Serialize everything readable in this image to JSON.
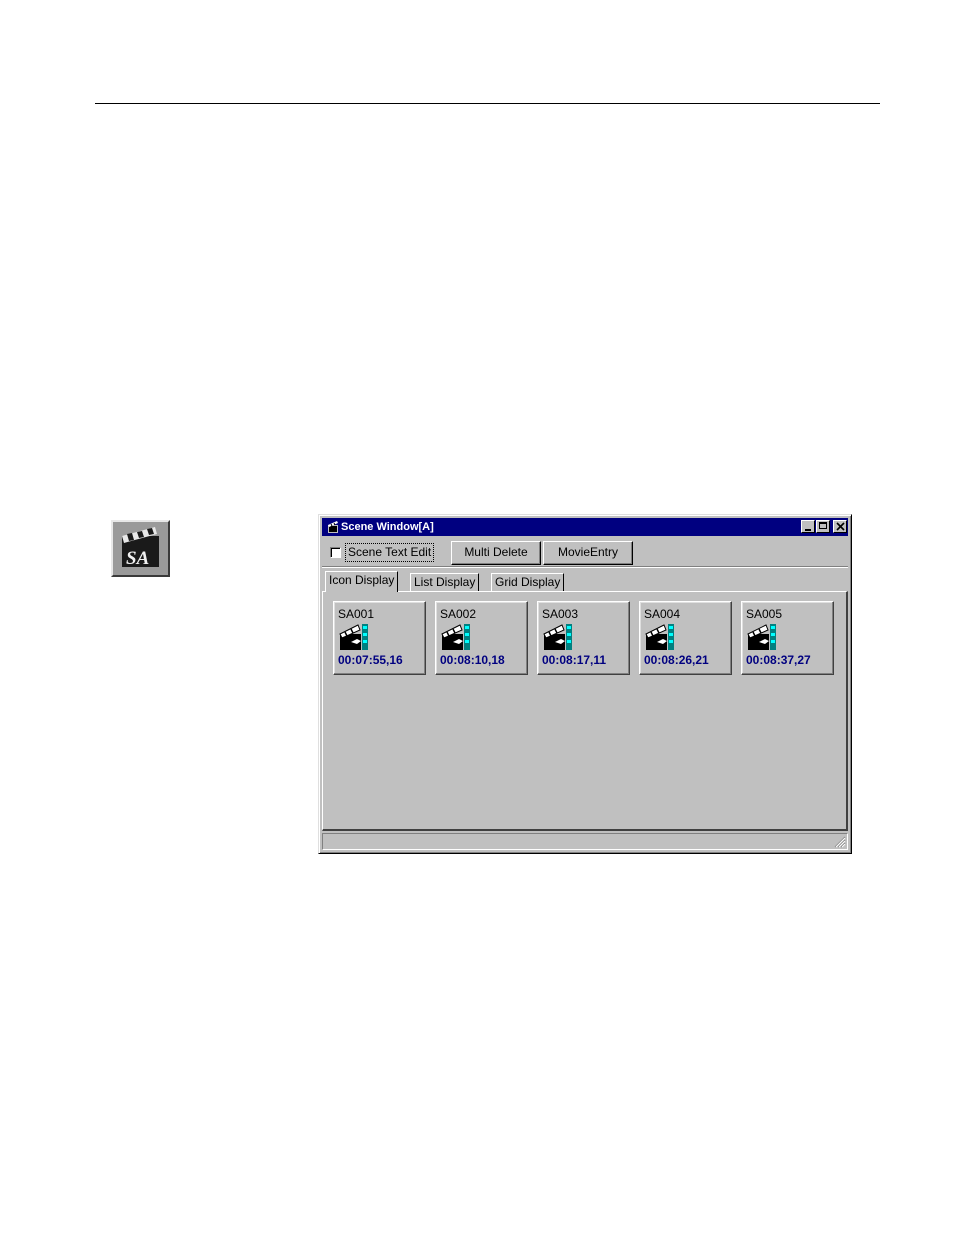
{
  "toolbar_icon": {
    "label": "SA"
  },
  "window": {
    "title": "Scene Window[A]",
    "checkbox_label": "Scene Text Edit",
    "checkbox_checked": false,
    "buttons": {
      "multi_delete": "Multi Delete",
      "movie_entry": "MovieEntry"
    },
    "tabs": [
      {
        "label": "Icon Display",
        "active": true
      },
      {
        "label": "List Display",
        "active": false
      },
      {
        "label": "Grid Display",
        "active": false
      }
    ],
    "scenes": [
      {
        "name": "SA001",
        "time": "00:07:55,16"
      },
      {
        "name": "SA002",
        "time": "00:08:10,18"
      },
      {
        "name": "SA003",
        "time": "00:08:17,11"
      },
      {
        "name": "SA004",
        "time": "00:08:26,21"
      },
      {
        "name": "SA005",
        "time": "00:08:37,27"
      }
    ],
    "colors": {
      "titlebar": "#000080",
      "face": "#c0c0c0",
      "timecode": "#000080"
    }
  }
}
